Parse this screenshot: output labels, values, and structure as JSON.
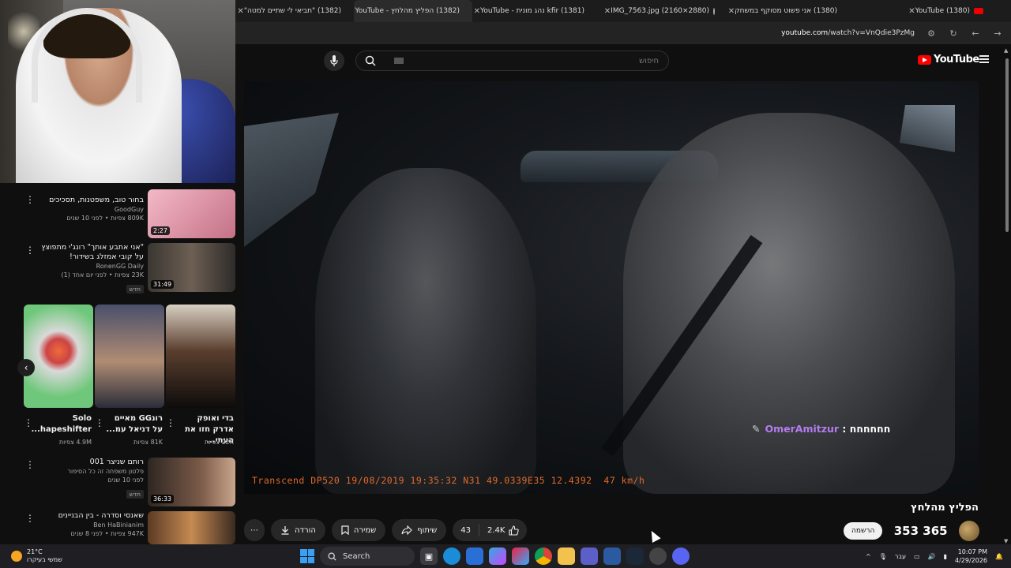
{
  "browser": {
    "tabs": [
      {
        "title": "(1382) \"תביאי לי שתיים למטה\"",
        "active": false,
        "favicon": "youtube"
      },
      {
        "title": "(1382) הפליץ מהלחץ - YouTube",
        "active": true,
        "favicon": "youtube"
      },
      {
        "title": "(1381) kfir נהג מונית - YouTube",
        "active": false,
        "favicon": "youtube"
      },
      {
        "title": "IMG_7563.jpg (2160×2880)",
        "active": false,
        "favicon": "globe"
      },
      {
        "title": "(1380) אני פשוט מסוקף במשחק",
        "active": false,
        "favicon": "youtube"
      },
      {
        "title": "(1380) YouTube",
        "active": false,
        "favicon": "youtube"
      }
    ],
    "url_domain": "youtube.com",
    "url_path": "/watch?v=VnQdie3PzMg"
  },
  "yt": {
    "search_placeholder": "חיפוש",
    "logo_text": "YouTube"
  },
  "video": {
    "dashcam_overlay": "Transcend DP520 19/08/2019 19:35:32 N31 49.0339E35 12.4392  47 km/h",
    "chat_user": "OmerAmitzur",
    "chat_sep": " : ",
    "chat_msg": "חחחחחח",
    "title": "הפליץ מהלחץ",
    "channel_name": "353 365",
    "subscribe_label": "הרשמה",
    "actions": {
      "download": "הורדה",
      "save": "שמירה",
      "share": "שיתוף",
      "dislikes": "43",
      "likes": "2.4K"
    }
  },
  "sidebar": {
    "videos_top": [
      {
        "title": "בחור טוב, משפטנות, תסכיכים",
        "channel": "GoodGuy",
        "meta": "809K צפיות • לפני 10 שנים",
        "duration": "2:27"
      },
      {
        "title": "\"אני אתבע אותך\" רונג'י מתפוצץ על קובי אמזלג בשידור!",
        "channel": "RonenGG Daily",
        "meta": "23K צפיות • לפני יום אחד (1)",
        "badge": "חדש",
        "duration": "31:49"
      }
    ],
    "shorts": [
      {
        "title": "Solo hapeshifter...",
        "views": "4.9M צפיות"
      },
      {
        "title": "רונGG מאיים על דניאל עמ...",
        "views": "81K צפיות"
      },
      {
        "title": "בדי ואופק אדרק חזו את העתי...",
        "views": "22K צפיות"
      }
    ],
    "videos_bottom": [
      {
        "title": "רותם שניצר 001",
        "channel": "פלטון משפחה זה כל הסיפור",
        "meta": "לפני 10 שנים",
        "badge": "חדש",
        "duration": "36:33"
      },
      {
        "title": "שאנסי וסדרה - בין הבניינים",
        "channel": "Ben HaBinianim",
        "meta": "947K צפיות • לפני 8 שנים",
        "duration": ""
      }
    ]
  },
  "taskbar": {
    "weather_temp": "21°C",
    "weather_desc": "שמשי בעיקרו",
    "search_label": "Search",
    "lang": "עבר",
    "time": "10:07 PM",
    "date": "4/29/2026"
  },
  "colors": {
    "yt_red": "#ff0000",
    "chat_user": "#b57cf0",
    "dashcam_text": "#e06a2a"
  }
}
